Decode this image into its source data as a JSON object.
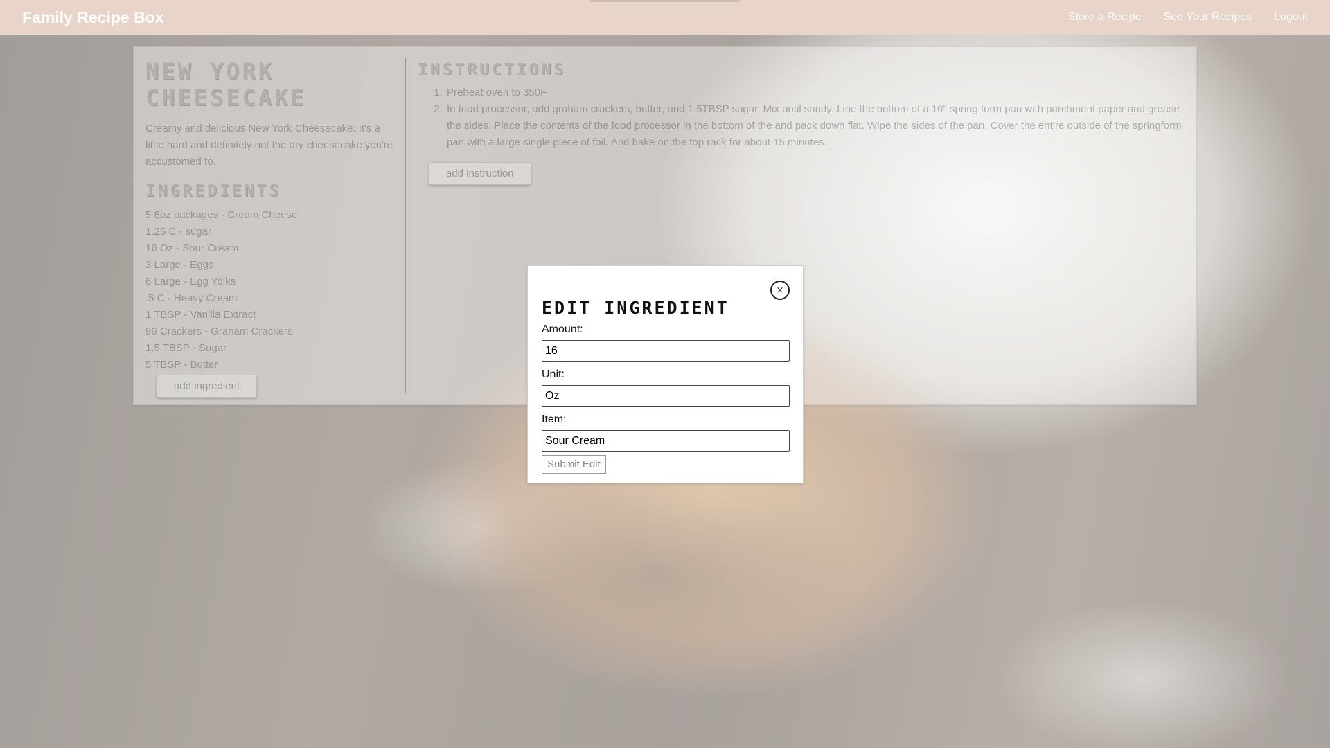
{
  "navbar": {
    "brand": "Family Recipe Box",
    "links": [
      "Store a Recipe",
      "See Your Recipes",
      "Logout"
    ]
  },
  "recipe": {
    "title": "NEW YORK CHEESECAKE",
    "description": "Creamy and delicious New York Cheesecake. It's a little hard and definitely not the dry cheesecake you're accustomed to.",
    "ingredients_heading": "INGREDIENTS",
    "ingredients": [
      "5 8oz packages - Cream Cheese",
      "1.25 C - sugar",
      "16 Oz - Sour Cream",
      "3 Large - Eggs",
      "6 Large - Egg Yolks",
      ".5 C - Heavy Cream",
      "1 TBSP - Vanilla Extract",
      "96 Crackers - Graham Crackers",
      "1.5 TBSP - Sugar",
      "5 TBSP - Butter"
    ],
    "add_ingredient_label": "add ingredient",
    "instructions_heading": "INSTRUCTIONS",
    "instructions": [
      "Preheat oven to 350F",
      "In food processor, add graham crackers, butter, and 1.5TBSP sugar. Mix until sandy. Line the bottom of a 10\" spring form pan with parchment paper and grease the sides. Place the contents of the food processor in the bottom of the and pack down flat. Wipe the sides of the pan. Cover the entire outside of the springform pan with a large single piece of foil. And bake on the top rack for about 15 minutes."
    ],
    "add_instruction_label": "add instruction"
  },
  "modal": {
    "title": "EDIT INGREDIENT",
    "close_symbol": "×",
    "amount_label": "Amount:",
    "amount_value": "16",
    "unit_label": "Unit:",
    "unit_value": "Oz",
    "item_label": "Item:",
    "item_value": "Sour Cream",
    "submit_label": "Submit Edit"
  },
  "colors": {
    "navbar_bg": "#e8d4c8",
    "modal_title": "#111111",
    "muted_text": "#8a8a8a"
  },
  "icons": {
    "close": "close-icon"
  }
}
